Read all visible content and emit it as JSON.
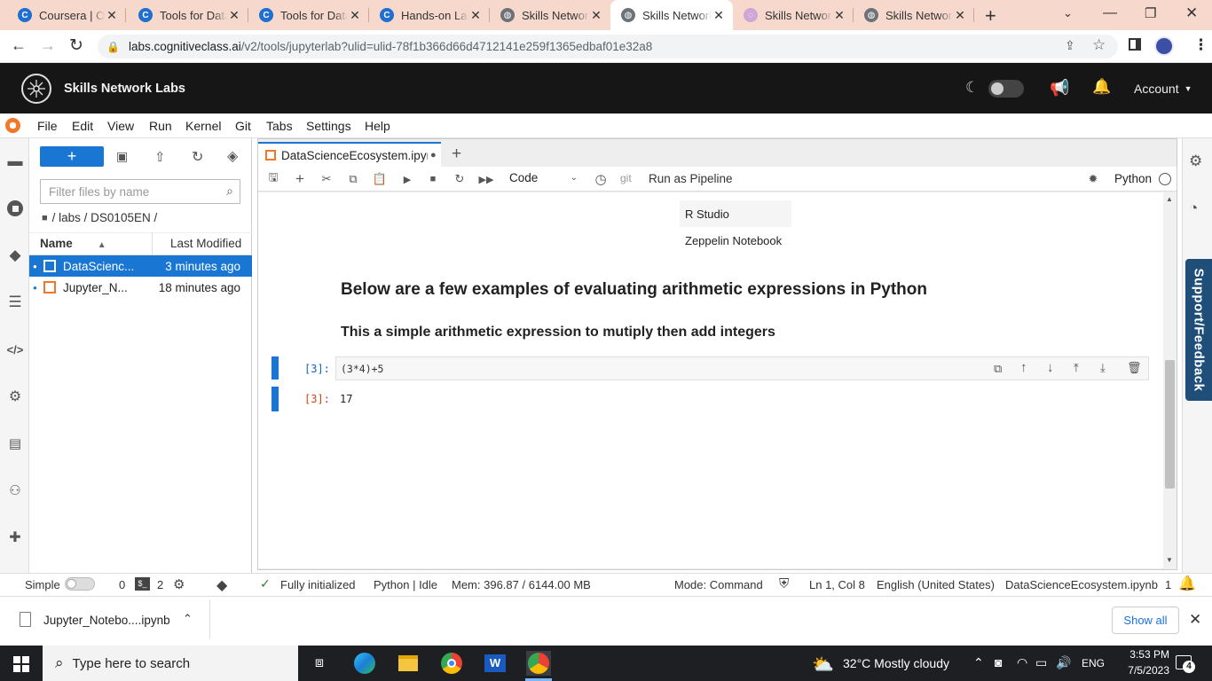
{
  "browser": {
    "tabs": [
      {
        "title": "Coursera | Online Courses",
        "icon": "coursera-icon"
      },
      {
        "title": "Tools for Data Science",
        "icon": "coursera-icon"
      },
      {
        "title": "Tools for Data Science",
        "icon": "coursera-icon"
      },
      {
        "title": "Hands-on Lab",
        "icon": "coursera-icon"
      },
      {
        "title": "Skills Network Labs",
        "icon": "globe-icon"
      },
      {
        "title": "Skills Network Labs",
        "icon": "globe-icon"
      },
      {
        "title": "Skills Network Labs",
        "icon": "loading-icon"
      },
      {
        "title": "Skills Network Labs",
        "icon": "globe-icon"
      }
    ],
    "active_tab_index": 5,
    "url_host": "labs.cognitiveclass.ai",
    "url_path": "/v2/tools/jupyterlab?ulid=ulid-78f1b366d66d4712141e259f1365edbaf01e32a8"
  },
  "header": {
    "title": "Skills Network Labs",
    "account_label": "Account"
  },
  "menubar": [
    "File",
    "Edit",
    "View",
    "Run",
    "Kernel",
    "Git",
    "Tabs",
    "Settings",
    "Help"
  ],
  "filebrowser": {
    "new_label": "+",
    "filter_placeholder": "Filter files by name",
    "breadcrumb": "/ labs / DS0105EN /",
    "col_name": "Name",
    "col_modified": "Last Modified",
    "files": [
      {
        "name": "DataScienc...",
        "modified": "3 minutes ago"
      },
      {
        "name": "Jupyter_N...",
        "modified": "18 minutes ago"
      }
    ]
  },
  "notebook": {
    "tab_title": "DataScienceEcosystem.ipynb",
    "cell_type": "Code",
    "git_label": "git",
    "pipeline_label": "Run as Pipeline",
    "kernel": "Python",
    "table_rows": [
      "R Studio",
      "Zeppelin Notebook"
    ],
    "heading1": "Below are a few examples of evaluating arithmetic expressions in Python",
    "heading2": "This a simple arithmetic expression to mutiply then add integers",
    "input_prompt": "[3]:",
    "input_code": "(3*4)+5",
    "output_prompt": "[3]:",
    "output_value": "17"
  },
  "sidebar_right": {
    "support_label": "Support/Feedback"
  },
  "statusbar": {
    "mode_simple": "Simple",
    "count_a": "0",
    "count_b": "2",
    "init": "Fully initialized",
    "kernel_state": "Python | Idle",
    "memory": "Mem: 396.87 / 6144.00 MB",
    "mode": "Mode: Command",
    "position": "Ln 1, Col 8",
    "language": "English (United States)",
    "filename": "DataScienceEcosystem.ipynb",
    "notif_count": "1"
  },
  "downloads": {
    "file": "Jupyter_Notebo....ipynb",
    "show_all": "Show all"
  },
  "taskbar": {
    "search_placeholder": "Type here to search",
    "weather": "32°C  Mostly cloudy",
    "lang": "ENG",
    "time": "3:53 PM",
    "date": "7/5/2023",
    "notif": "4"
  }
}
